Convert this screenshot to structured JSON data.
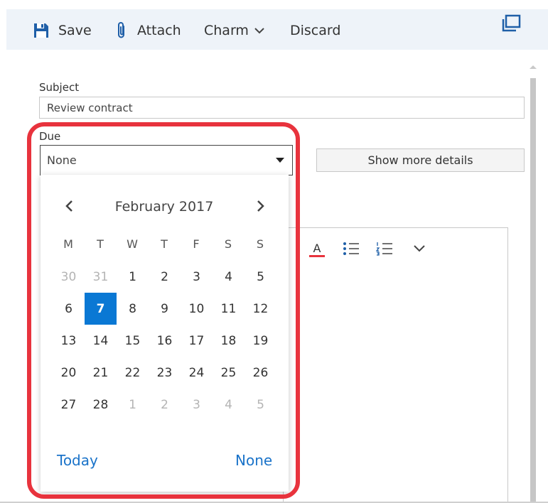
{
  "toolbar": {
    "save_label": "Save",
    "attach_label": "Attach",
    "charm_label": "Charm",
    "discard_label": "Discard"
  },
  "form": {
    "subject_label": "Subject",
    "subject_value": "Review contract",
    "due_label": "Due",
    "due_value": "None",
    "more_details_label": "Show more details"
  },
  "calendar": {
    "month_title": "February 2017",
    "weekdays": [
      "M",
      "T",
      "W",
      "T",
      "F",
      "S",
      "S"
    ],
    "weeks": [
      [
        "30",
        "31",
        "1",
        "2",
        "3",
        "4",
        "5"
      ],
      [
        "6",
        "7",
        "8",
        "9",
        "10",
        "11",
        "12"
      ],
      [
        "13",
        "14",
        "15",
        "16",
        "17",
        "18",
        "19"
      ],
      [
        "20",
        "21",
        "22",
        "23",
        "24",
        "25",
        "26"
      ],
      [
        "27",
        "28",
        "1",
        "2",
        "3",
        "4",
        "5"
      ]
    ],
    "selected_day": "7",
    "today_label": "Today",
    "none_label": "None"
  },
  "colors": {
    "accent": "#0a78d4",
    "link": "#1a73c9",
    "highlight": "#e8333d",
    "toolbar_bg": "#eef3f9",
    "font_color_bar": "#e8333d"
  },
  "icons": {
    "save": "floppy-disk-icon",
    "attach": "paperclip-icon",
    "charm_dropdown": "chevron-down-icon",
    "popout": "popout-window-icon",
    "prev_month": "chevron-left-icon",
    "next_month": "chevron-right-icon",
    "font_color": "font-color-icon",
    "bullets": "bulleted-list-icon",
    "numbering": "numbered-list-icon",
    "more_formatting": "chevron-down-icon"
  }
}
